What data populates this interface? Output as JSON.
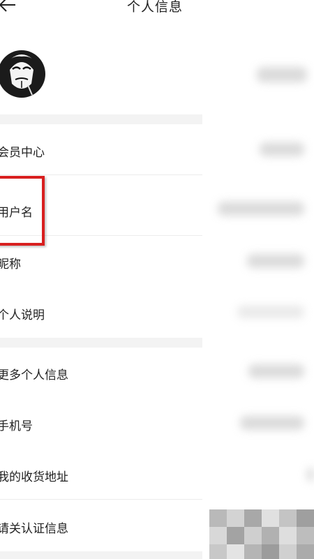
{
  "header": {
    "title": "个人信息",
    "back_icon": "arrow-left-icon"
  },
  "avatar": {
    "icon": "mask-avatar-icon"
  },
  "items": [
    {
      "label": "会员中心"
    },
    {
      "label": "用户名"
    },
    {
      "label": "昵称"
    },
    {
      "label": "个人说明"
    },
    {
      "label": "更多个人信息"
    },
    {
      "label": "手机号"
    },
    {
      "label": "我的收货地址"
    },
    {
      "label": "请关认证信息"
    }
  ],
  "colors": {
    "highlight": "#d81f1f",
    "background": "#ffffff",
    "separator": "#f3f3f3"
  }
}
